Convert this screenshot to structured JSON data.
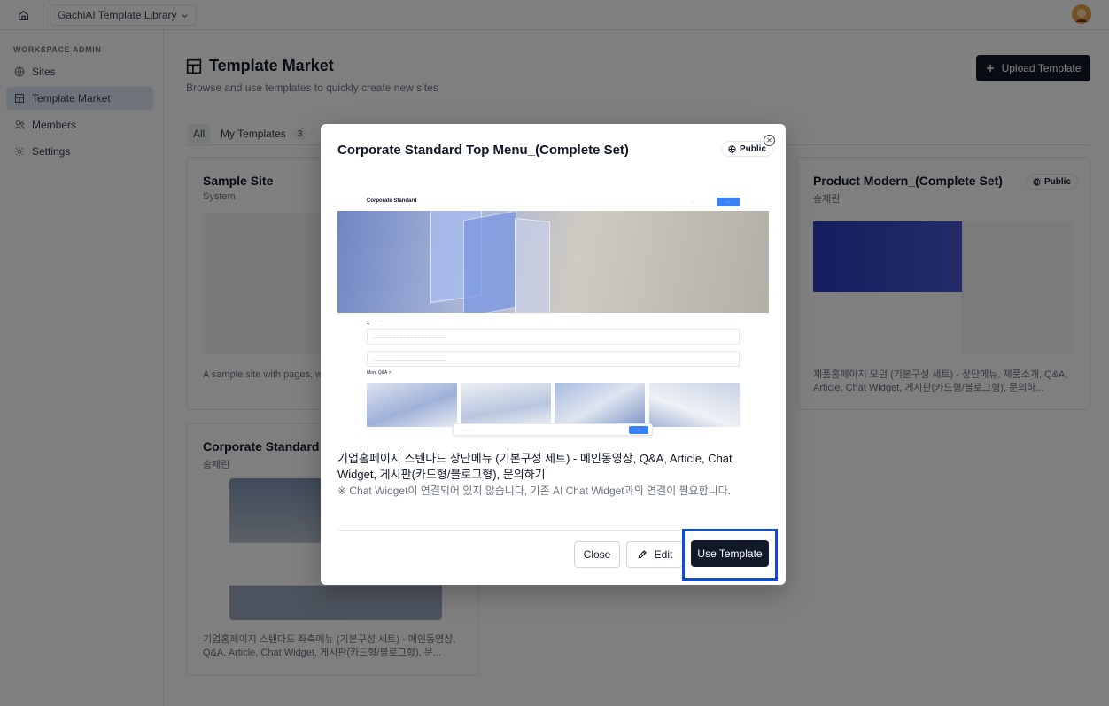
{
  "header": {
    "library_name": "GachiAI Template Library"
  },
  "sidebar": {
    "section_title": "WORKSPACE ADMIN",
    "items": [
      {
        "label": "Sites",
        "icon": "globe-icon"
      },
      {
        "label": "Template Market",
        "icon": "template-icon"
      },
      {
        "label": "Members",
        "icon": "users-icon"
      },
      {
        "label": "Settings",
        "icon": "gear-icon"
      }
    ],
    "active_index": 1
  },
  "main": {
    "title": "Template Market",
    "subtitle": "Browse and use templates to quickly create new sites",
    "upload_label": "Upload Template",
    "tabs": [
      {
        "label": "All"
      },
      {
        "label": "My Templates",
        "count": "3"
      }
    ],
    "cards": [
      {
        "title": "Sample Site",
        "author": "System",
        "desc": "A sample site with pages, w... you get started."
      },
      {
        "title": "Product Modern_(Complete Set)",
        "author": "송제린",
        "badge": "Public",
        "desc": "제품홈페이지 모던 (기본구성 세트) - 상단메뉴, 제품소개, Q&A, Article, Chat Widget, 게시판(카드형/블로그형), 문의하..."
      },
      {
        "title": "Corporate Standard L...",
        "author": "송제린",
        "desc": "기업홈페이지 스텐다드 좌측메뉴 (기본구성 세트) - 메인동영상, Q&A, Article, Chat Widget, 게시판(카드형/블로그형), 문..."
      }
    ]
  },
  "modal": {
    "title": "Corporate Standard Top Menu_(Complete Set)",
    "badge": "Public",
    "close_glyph": "✕",
    "preview": {
      "logo": "Corporate Standard",
      "more": "More Q&A  >"
    },
    "description": "기업홈페이지 스텐다드 상단메뉴 (기본구성 세트) - 메인동영상, Q&A, Article, Chat Widget, 게시판(카드형/블로그형), 문의하기",
    "note": "※ Chat Widget이 연결되어 있지 않습니다, 기존 AI Chat Widget과의 연결이 필요합니다.",
    "buttons": {
      "close": "Close",
      "edit": "Edit",
      "use": "Use Template"
    }
  },
  "colors": {
    "primary": "#111827",
    "overlay": "rgba(0,0,0,0.5)",
    "highlight": "#0a4fd4",
    "active_nav": "#dbe6f3"
  }
}
